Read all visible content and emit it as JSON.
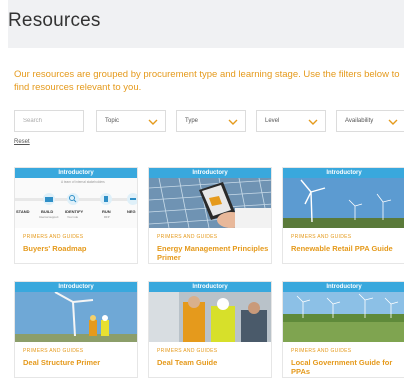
{
  "page": {
    "title": "Resources",
    "intro": "Our resources are grouped by procurement type and learning stage. Use the filters below to find resources relevant to you."
  },
  "filters": {
    "search_placeholder": "Search",
    "selects": [
      {
        "label": "Topic"
      },
      {
        "label": "Type"
      },
      {
        "label": "Level"
      },
      {
        "label": "Availability"
      }
    ],
    "reset_label": "Reset"
  },
  "colors": {
    "accent": "#e59a1c",
    "badge": "#39a8dd"
  },
  "cards": [
    {
      "badge": "Introductory",
      "category": "PRIMERS AND GUIDES",
      "title": "Buyers' Roadmap",
      "diagram": {
        "caption": "A team of internal stakeholders",
        "steps": [
          "STAND",
          "BUILD",
          "IDENTIFY",
          "RUN",
          "NEG"
        ],
        "subs": [
          "",
          "Internal support",
          "Your role",
          "RFP",
          ""
        ]
      }
    },
    {
      "badge": "Introductory",
      "category": "PRIMERS AND GUIDES",
      "title": "Energy Management Principles Primer"
    },
    {
      "badge": "Introductory",
      "category": "PRIMERS AND GUIDES",
      "title": "Renewable Retail PPA Guide"
    },
    {
      "badge": "Introductory",
      "category": "PRIMERS AND GUIDES",
      "title": "Deal Structure Primer"
    },
    {
      "badge": "Introductory",
      "category": "PRIMERS AND GUIDES",
      "title": "Deal Team Guide"
    },
    {
      "badge": "Introductory",
      "category": "PRIMERS AND GUIDES",
      "title": "Local Government Guide for PPAs"
    }
  ]
}
